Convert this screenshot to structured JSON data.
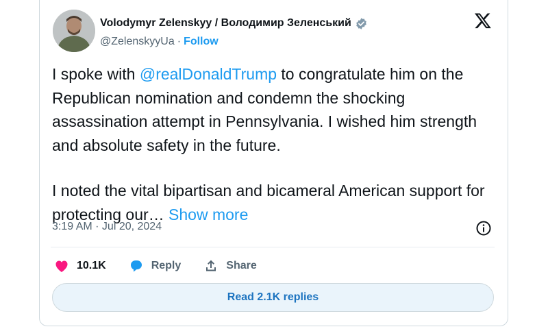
{
  "author": {
    "name": "Volodymyr Zelenskyy / Володимир Зеленський",
    "handle": "@ZelenskyyUa",
    "separator": "·",
    "follow_label": "Follow"
  },
  "tweet": {
    "p1_mention": "@realDonaldTrump",
    "p1_text": " to congratulate him on the Republican nomination and condemn the shocking assassination attempt in Pennsylvania. I wished him strength and absolute safety in the future.",
    "p1_prefix": "I spoke with ",
    "p2_text": "I noted the vital bipartisan and bicameral American support for protecting our… ",
    "show_more": "Show more"
  },
  "timestamp": "3:19 AM · Jul 20, 2024",
  "actions": {
    "like_count": "10.1K",
    "reply_label": "Reply",
    "share_label": "Share"
  },
  "read_replies_label": "Read 2.1K replies",
  "icons": [
    "avatar",
    "verified-badge-icon",
    "x-logo-icon",
    "info-icon",
    "heart-icon",
    "reply-bubble-icon",
    "share-icon"
  ],
  "colors": {
    "link": "#1d9bf0",
    "like": "#f91880",
    "text": "#0f1419",
    "muted": "#536471"
  }
}
